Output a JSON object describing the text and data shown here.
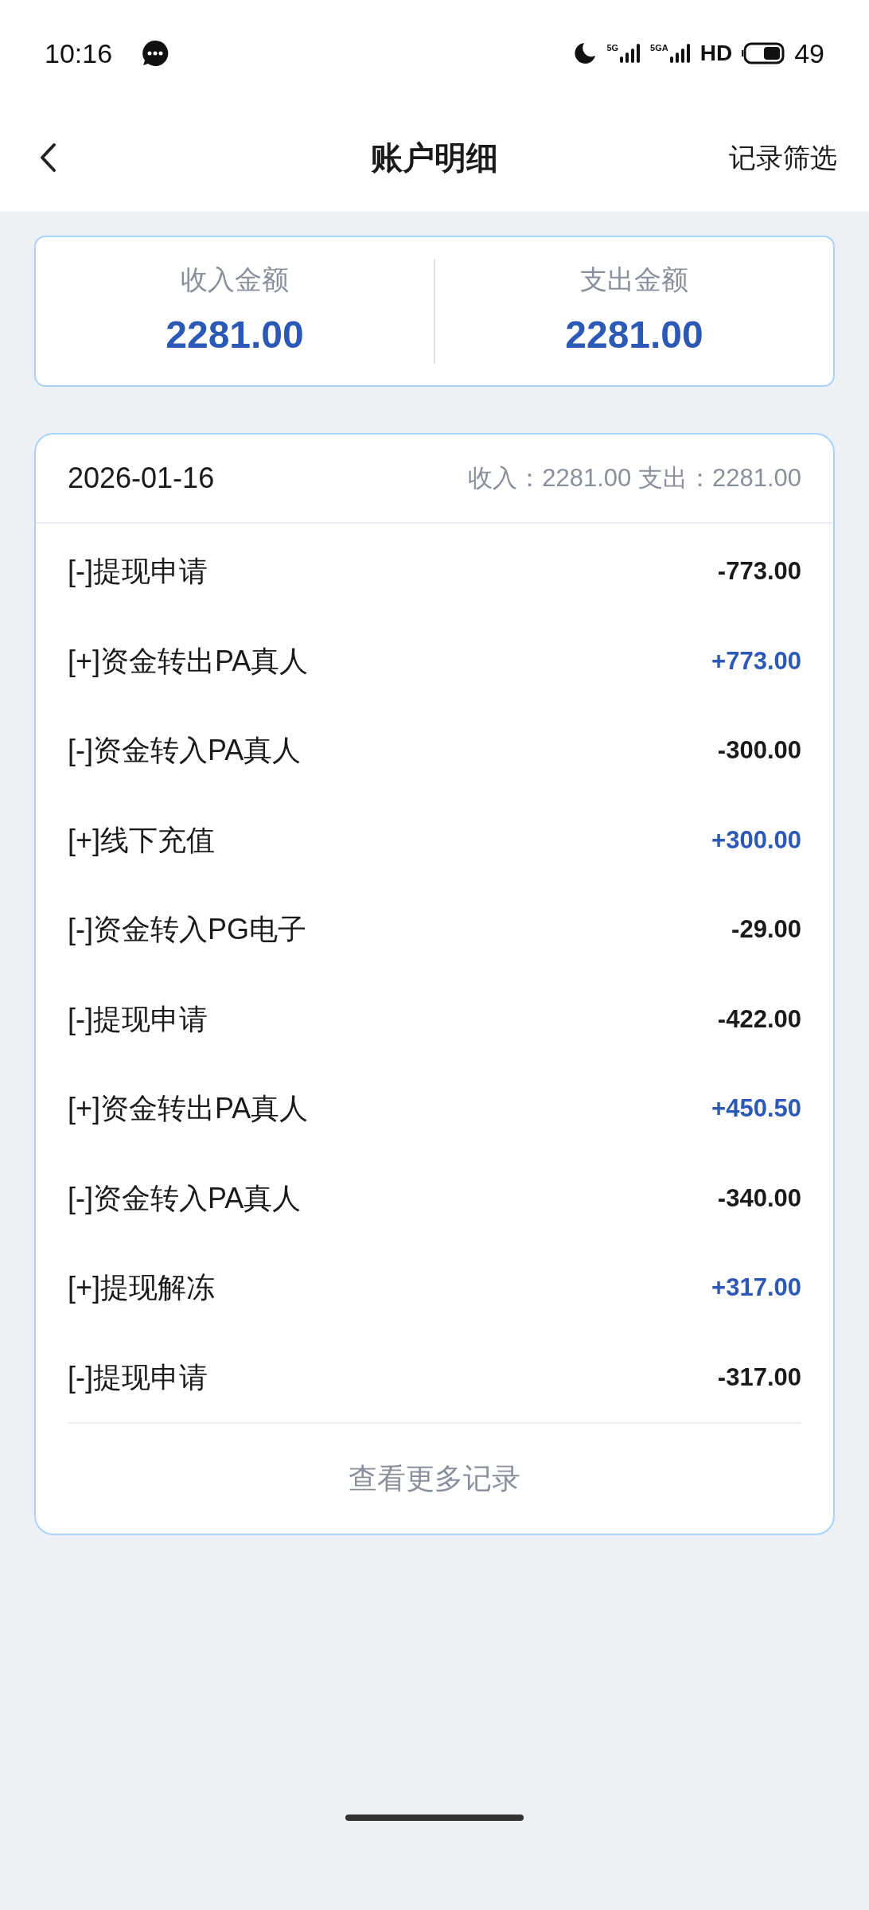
{
  "status_bar": {
    "time": "10:16",
    "signals": [
      "5G",
      "5GA"
    ],
    "hd": "HD",
    "battery": "49"
  },
  "header": {
    "title": "账户明细",
    "action": "记录筛选"
  },
  "summary": [
    {
      "label": "收入金额",
      "value": "2281.00"
    },
    {
      "label": "支出金额",
      "value": "2281.00"
    }
  ],
  "day": {
    "date": "2026-01-16",
    "totals": "收入：2281.00 支出：2281.00",
    "rows": [
      {
        "name": "[-]提现申请",
        "amount": "-773.00",
        "kind": "expense"
      },
      {
        "name": "[+]资金转出PA真人",
        "amount": "+773.00",
        "kind": "income"
      },
      {
        "name": "[-]资金转入PA真人",
        "amount": "-300.00",
        "kind": "expense"
      },
      {
        "name": "[+]线下充值",
        "amount": "+300.00",
        "kind": "income"
      },
      {
        "name": "[-]资金转入PG电子",
        "amount": "-29.00",
        "kind": "expense"
      },
      {
        "name": "[-]提现申请",
        "amount": "-422.00",
        "kind": "expense"
      },
      {
        "name": "[+]资金转出PA真人",
        "amount": "+450.50",
        "kind": "income"
      },
      {
        "name": "[-]资金转入PA真人",
        "amount": "-340.00",
        "kind": "expense"
      },
      {
        "name": "[+]提现解冻",
        "amount": "+317.00",
        "kind": "income"
      },
      {
        "name": "[-]提现申请",
        "amount": "-317.00",
        "kind": "expense"
      }
    ],
    "more": "查看更多记录"
  }
}
